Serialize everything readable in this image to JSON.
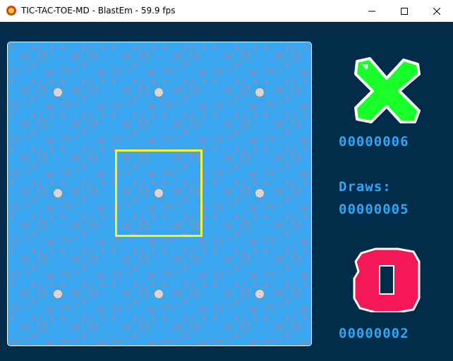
{
  "window": {
    "title": "TIC-TAC-TOE-MD - BlastEm - 59.9 fps",
    "minimize_icon": "minimize-icon",
    "maximize_icon": "maximize-icon",
    "close_icon": "close-icon",
    "app_icon": "blastem-app-icon"
  },
  "colors": {
    "background": "#032b4a",
    "board": "#3aa6f0",
    "cursor": "#f2f23a",
    "player_x": "#19ff2a",
    "player_o": "#f51856",
    "score_text": "#2aa8f6"
  },
  "game": {
    "board": {
      "cells": [
        "empty",
        "empty",
        "empty",
        "empty",
        "empty",
        "empty",
        "empty",
        "empty",
        "empty"
      ],
      "selected_cell": 4
    },
    "score_x": "00000006",
    "draws_label": "Draws:",
    "score_draws": "00000005",
    "score_o": "00000002"
  }
}
